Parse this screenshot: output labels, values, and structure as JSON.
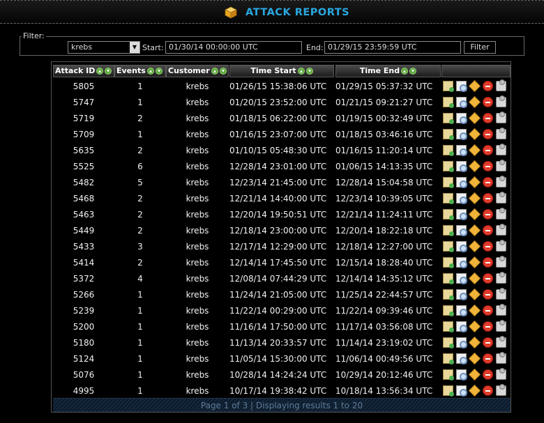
{
  "app": {
    "title": "ATTACK REPORTS",
    "icon": "box-icon"
  },
  "filter": {
    "legend": "Filter:",
    "customer_value": "krebs",
    "start_label": "Start:",
    "start_value": "01/30/14 00:00:00 UTC",
    "end_label": "End:",
    "end_value": "01/29/15 23:59:59 UTC",
    "button_label": "Filter"
  },
  "table": {
    "columns": [
      "Attack ID",
      "Events",
      "Customer",
      "Time Start",
      "Time End"
    ],
    "rows": [
      {
        "id": "5805",
        "events": "1",
        "customer": "krebs",
        "start": "01/26/15 15:38:06 UTC",
        "end": "01/29/15 05:37:32 UTC"
      },
      {
        "id": "5747",
        "events": "1",
        "customer": "krebs",
        "start": "01/20/15 23:52:00 UTC",
        "end": "01/21/15 09:21:27 UTC"
      },
      {
        "id": "5719",
        "events": "2",
        "customer": "krebs",
        "start": "01/18/15 06:22:00 UTC",
        "end": "01/19/15 00:32:49 UTC"
      },
      {
        "id": "5709",
        "events": "1",
        "customer": "krebs",
        "start": "01/16/15 23:07:00 UTC",
        "end": "01/18/15 03:46:16 UTC"
      },
      {
        "id": "5635",
        "events": "2",
        "customer": "krebs",
        "start": "01/10/15 05:48:30 UTC",
        "end": "01/16/15 11:20:14 UTC"
      },
      {
        "id": "5525",
        "events": "6",
        "customer": "krebs",
        "start": "12/28/14 23:01:00 UTC",
        "end": "01/06/15 14:13:35 UTC"
      },
      {
        "id": "5482",
        "events": "5",
        "customer": "krebs",
        "start": "12/23/14 21:45:00 UTC",
        "end": "12/28/14 15:04:58 UTC"
      },
      {
        "id": "5468",
        "events": "2",
        "customer": "krebs",
        "start": "12/21/14 14:40:00 UTC",
        "end": "12/23/14 10:39:05 UTC"
      },
      {
        "id": "5463",
        "events": "2",
        "customer": "krebs",
        "start": "12/20/14 19:50:51 UTC",
        "end": "12/21/14 11:24:11 UTC"
      },
      {
        "id": "5449",
        "events": "2",
        "customer": "krebs",
        "start": "12/18/14 23:00:00 UTC",
        "end": "12/20/14 18:22:18 UTC"
      },
      {
        "id": "5433",
        "events": "3",
        "customer": "krebs",
        "start": "12/17/14 12:29:00 UTC",
        "end": "12/18/14 12:27:00 UTC"
      },
      {
        "id": "5414",
        "events": "2",
        "customer": "krebs",
        "start": "12/14/14 17:45:50 UTC",
        "end": "12/15/14 18:28:40 UTC"
      },
      {
        "id": "5372",
        "events": "4",
        "customer": "krebs",
        "start": "12/08/14 07:44:29 UTC",
        "end": "12/14/14 14:35:12 UTC"
      },
      {
        "id": "5266",
        "events": "1",
        "customer": "krebs",
        "start": "11/24/14 21:05:00 UTC",
        "end": "11/25/14 22:44:57 UTC"
      },
      {
        "id": "5239",
        "events": "1",
        "customer": "krebs",
        "start": "11/22/14 00:29:00 UTC",
        "end": "11/22/14 09:39:46 UTC"
      },
      {
        "id": "5200",
        "events": "1",
        "customer": "krebs",
        "start": "11/16/14 17:50:00 UTC",
        "end": "11/17/14 03:56:08 UTC"
      },
      {
        "id": "5180",
        "events": "1",
        "customer": "krebs",
        "start": "11/13/14 20:33:57 UTC",
        "end": "11/14/14 23:19:02 UTC"
      },
      {
        "id": "5124",
        "events": "1",
        "customer": "krebs",
        "start": "11/05/14 15:30:00 UTC",
        "end": "11/06/14 00:49:56 UTC"
      },
      {
        "id": "5076",
        "events": "1",
        "customer": "krebs",
        "start": "10/28/14 14:24:24 UTC",
        "end": "10/29/14 20:12:46 UTC"
      },
      {
        "id": "4995",
        "events": "1",
        "customer": "krebs",
        "start": "10/17/14 19:38:42 UTC",
        "end": "10/18/14 13:56:34 UTC"
      }
    ],
    "row_icons": [
      "edit-report-icon",
      "view-report-icon",
      "package-icon",
      "delete-icon",
      "export-icon"
    ]
  },
  "pager": {
    "text": "Page 1 of 3 | Displaying results 1 to 20"
  }
}
